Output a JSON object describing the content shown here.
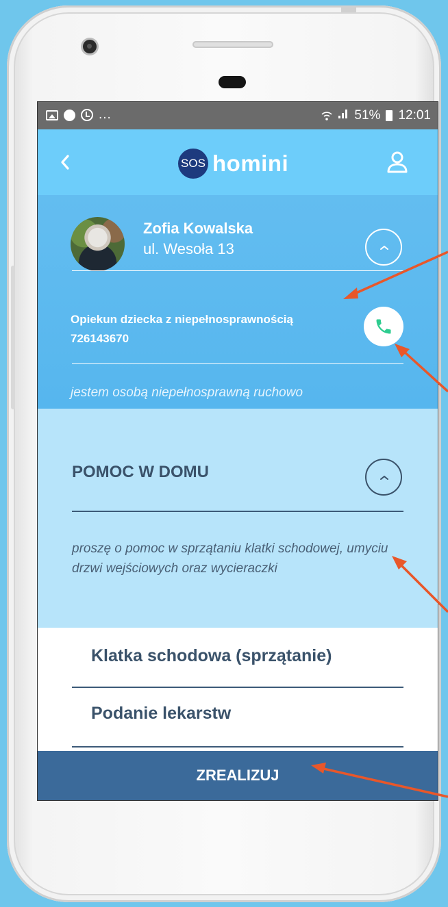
{
  "status_bar": {
    "left_more": "...",
    "battery_percent": "51%",
    "time": "12:01"
  },
  "app_bar": {
    "logo_badge": "SOS",
    "logo_text": "homini"
  },
  "user_card": {
    "name": "Zofia Kowalska",
    "address": "ul. Wesoła 13",
    "caregiver_title": "Opiekun dziecka z niepełnosprawnością",
    "caregiver_phone": "726143670",
    "note": "jestem osobą niepełnosprawną ruchowo"
  },
  "request": {
    "title": "POMOC W DOMU",
    "description": "proszę o pomoc w sprzątaniu klatki schodowej, umyciu drzwi wejściowych oraz wycieraczki"
  },
  "tasks": [
    {
      "label": "Klatka schodowa (sprzątanie)"
    },
    {
      "label": "Podanie lekarstw"
    }
  ],
  "action_button": {
    "label": "ZREALIZUJ"
  },
  "colors": {
    "background": "#6fc6ec",
    "app_bar": "#6dcdfa",
    "user_card": "#5cb9ef",
    "request_panel": "#b7e4fa",
    "action_button": "#3b6a9a",
    "logo_badge": "#1d3a7e",
    "call_icon": "#2ecc8f",
    "annotation_arrow": "#e8572a"
  },
  "icons": {
    "back": "chevron-left-icon",
    "profile": "user-icon",
    "collapse": "chevron-up-icon",
    "call": "phone-icon"
  }
}
